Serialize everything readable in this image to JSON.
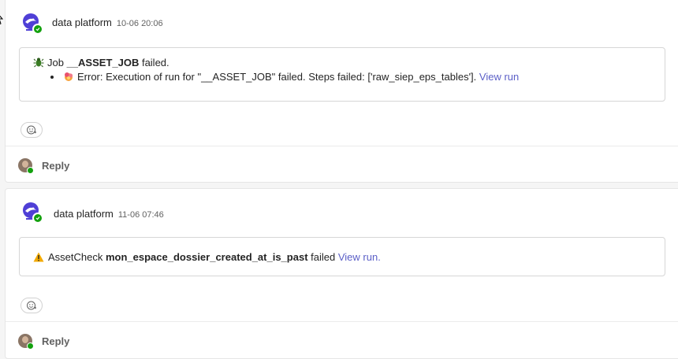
{
  "messages": [
    {
      "sender": "data platform",
      "time": "10-06 20:06",
      "title_prefix": "Job ",
      "title_bold": "__ASSET_JOB",
      "title_suffix": " failed.",
      "error_text": "Error: Execution of run for \"__ASSET_JOB\" failed. Steps failed: ['raw_siep_eps_tables']. ",
      "link_text": "View run",
      "reply_label": "Reply"
    },
    {
      "sender": "data platform",
      "time": "11-06 07:46",
      "prefix": "AssetCheck ",
      "bold": "mon_espace_dossier_created_at_is_past",
      "suffix": " failed ",
      "link_text": "View run",
      "link_suffix": ".",
      "reply_label": "Reply"
    }
  ],
  "icons": {
    "bot_avatar": "bot-avatar-icon",
    "job_icon": "bug-icon",
    "error_icon": "error-burst-icon",
    "warning_icon": "warning-icon",
    "reaction_icon": "add-reaction-icon"
  },
  "colors": {
    "link": "#5b5fc7",
    "presence": "#13a10e",
    "bot_brand": "#4f3fd6",
    "warning": "#f2a900"
  }
}
